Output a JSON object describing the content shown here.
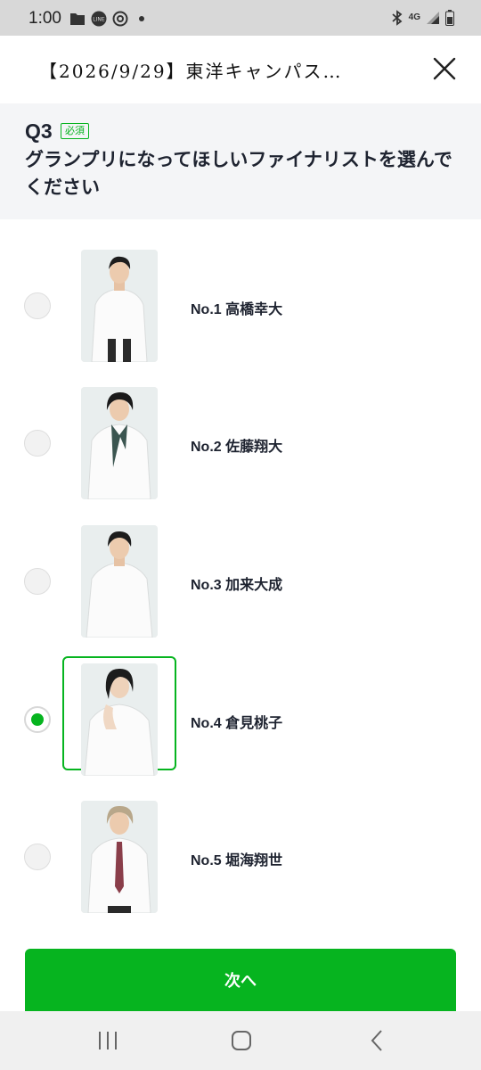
{
  "status_bar": {
    "time": "1:00",
    "network": "4G",
    "icons_left": [
      "folder-icon",
      "line-icon",
      "threads-icon",
      "dot-icon"
    ],
    "icons_right": [
      "bluetooth-icon",
      "4g-icon",
      "signal-icon",
      "battery-icon"
    ]
  },
  "header": {
    "title": "【2026/9/29】東洋キャンパス…",
    "close_icon": "close-icon"
  },
  "question": {
    "number": "Q3",
    "required_badge": "必須",
    "text": "グランプリになってほしいファイナリストを選んでください"
  },
  "options": [
    {
      "label": "No.1 高橋幸大",
      "selected": false
    },
    {
      "label": "No.2 佐藤翔大",
      "selected": false
    },
    {
      "label": "No.3 加来大成",
      "selected": false
    },
    {
      "label": "No.4 倉見桃子",
      "selected": true
    },
    {
      "label": "No.5 堀海翔世",
      "selected": false
    }
  ],
  "next_button": {
    "label": "次へ"
  },
  "nav_bar": {
    "icons": [
      "recent-apps-icon",
      "home-icon",
      "back-icon"
    ]
  },
  "colors": {
    "accent": "#06b41f",
    "question_bg": "#f4f5f7",
    "text": "#1e2330",
    "status_bar_bg": "#d8d8d8"
  }
}
